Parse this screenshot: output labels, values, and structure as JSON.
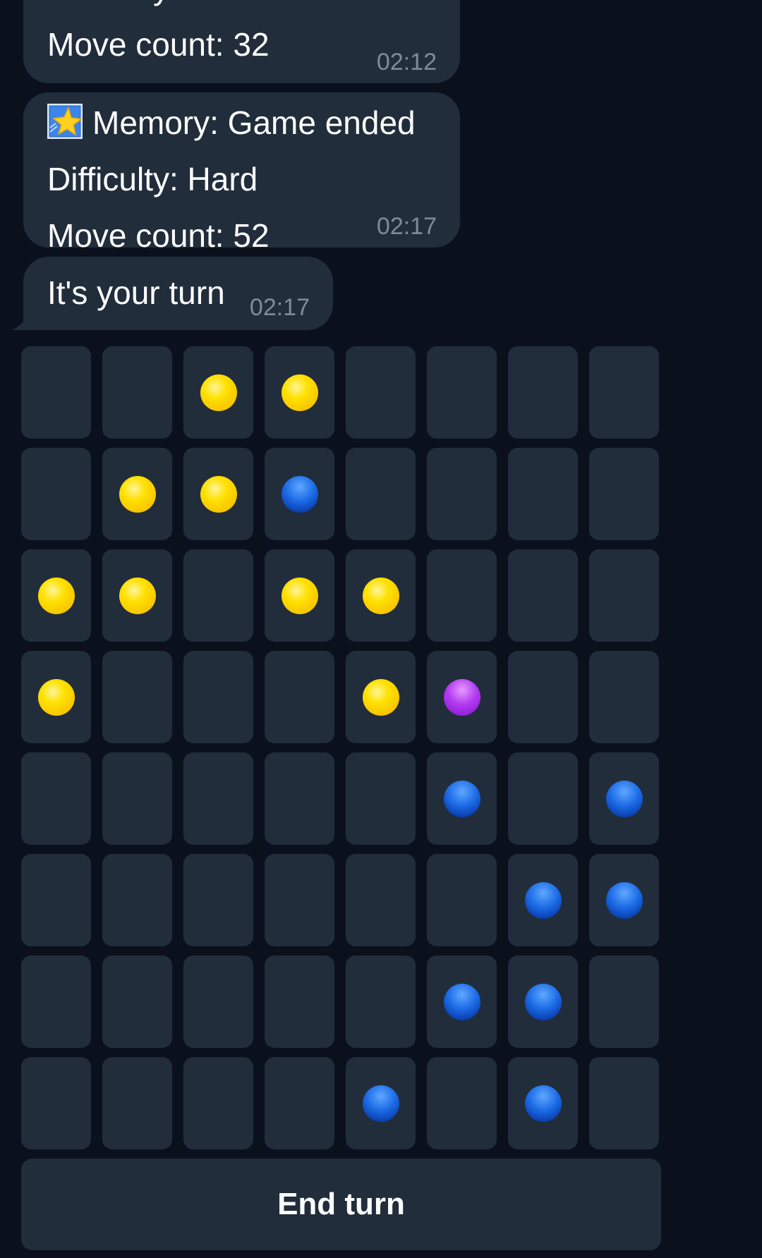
{
  "messages": [
    {
      "lines": [
        "Difficulty: Normal",
        "Move count: 32"
      ],
      "time": "02:12"
    },
    {
      "icon": "star-icon",
      "lines": [
        "Memory: Game ended",
        "Difficulty: Hard",
        "Move count: 52"
      ],
      "time": "02:17"
    },
    {
      "lines": [
        "It's your turn"
      ],
      "time": "02:17"
    }
  ],
  "board": {
    "rows": 8,
    "cols": 8,
    "cells": [
      [
        "",
        "",
        "yellow",
        "yellow",
        "",
        "",
        "",
        ""
      ],
      [
        "",
        "yellow",
        "yellow",
        "blue",
        "",
        "",
        "",
        ""
      ],
      [
        "yellow",
        "yellow",
        "",
        "yellow",
        "yellow",
        "",
        "",
        ""
      ],
      [
        "yellow",
        "",
        "",
        "",
        "yellow",
        "purple",
        "",
        ""
      ],
      [
        "",
        "",
        "",
        "",
        "",
        "blue",
        "",
        "blue"
      ],
      [
        "",
        "",
        "",
        "",
        "",
        "",
        "blue",
        "blue"
      ],
      [
        "",
        "",
        "",
        "",
        "",
        "blue",
        "blue",
        ""
      ],
      [
        "",
        "",
        "",
        "",
        "blue",
        "",
        "blue",
        ""
      ]
    ]
  },
  "actions": {
    "end_turn_label": "End turn"
  },
  "colors": {
    "background": "#0b111c",
    "bubble": "#212d3b",
    "timestamp": "#7d8b9a",
    "yellow": "#ffd600",
    "blue": "#1d6ce6",
    "purple": "#b43cf2"
  }
}
